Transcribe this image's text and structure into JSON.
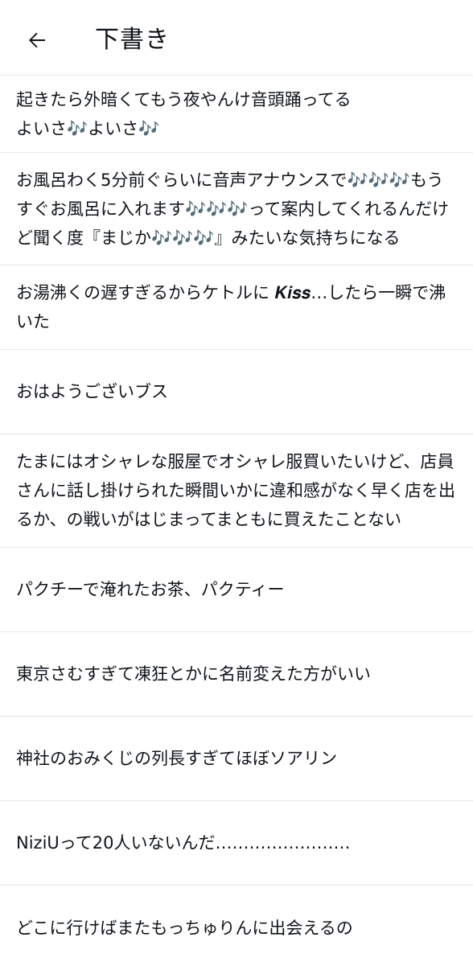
{
  "header": {
    "title": "下書き",
    "back_icon": "arrow-left-icon"
  },
  "drafts": [
    "起きたら外暗くてもう夜やんけ音頭踊ってる\nよいさ🎶よいさ🎶",
    "お風呂わく5分前ぐらいに音声アナウンスで🎶🎶🎶もうすぐお風呂に入れます🎶🎶🎶って案内してくれるんだけど聞く度『まじか🎶🎶🎶』みたいな気持ちになる",
    "お湯沸くの遅すぎるからケトルに 𝑲𝒊𝒔𝒔…したら一瞬で沸いた",
    "おはようございブス",
    "たまにはオシャレな服屋でオシャレ服買いたいけど、店員さんに話し掛けられた瞬間いかに違和感がなく早く店を出るか、の戦いがはじまってまともに買えたことない",
    "パクチーで淹れたお茶、パクティー",
    "東京さむすぎて凍狂とかに名前変えた方がいい",
    "神社のおみくじの列長すぎてほぼソアリン",
    "NiziUって20人いないんだ……………………",
    "どこに行けばまたもっちゅりんに出会えるの"
  ]
}
